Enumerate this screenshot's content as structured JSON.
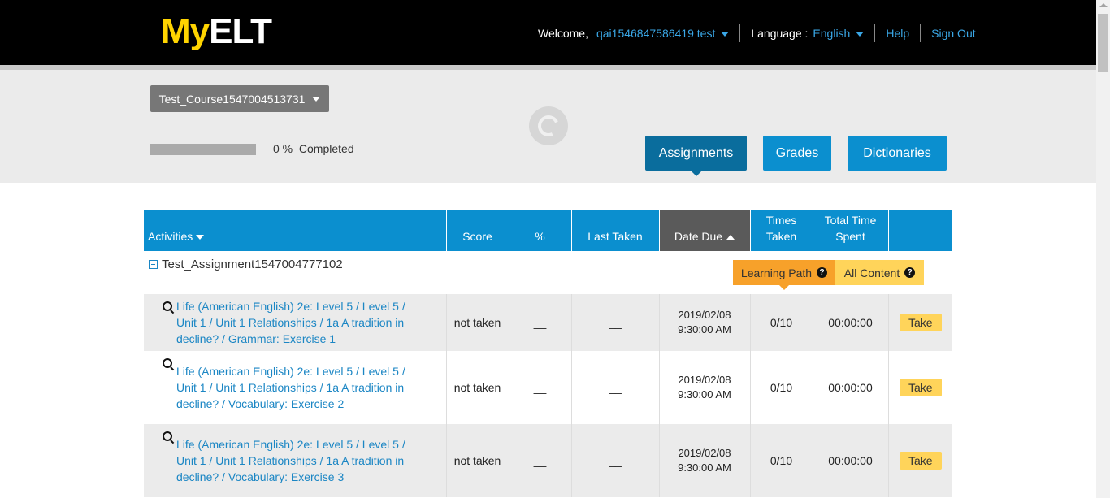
{
  "header": {
    "logo_my": "My",
    "logo_elt": "ELT",
    "welcome_label": "Welcome,",
    "username": "qai1546847586419 test",
    "language_label": "Language :",
    "language_value": "English",
    "help": "Help",
    "sign_out": "Sign Out"
  },
  "course": {
    "selector_label": "Test_Course1547004513731",
    "progress_percent": 0,
    "progress_text": "0 %  Completed"
  },
  "tabs": [
    {
      "label": "Assignments",
      "active": true
    },
    {
      "label": "Grades",
      "active": false
    },
    {
      "label": "Dictionaries",
      "active": false
    }
  ],
  "table": {
    "headers": {
      "activities": "Activities",
      "score": "Score",
      "percent": "%",
      "last_taken": "Last Taken",
      "date_due": "Date Due",
      "times_taken_1": "Times",
      "times_taken_2": "Taken",
      "total_time_1": "Total Time",
      "total_time_2": "Spent"
    },
    "group_title": "Test_Assignment1547004777102",
    "filters": {
      "learning_path": "Learning Path",
      "all_content": "All Content"
    },
    "rows": [
      {
        "activity": "Life (American English) 2e: Level 5 / Level 5 / Unit 1 / Unit 1 Relationships / 1a A tradition in decline? / Grammar: Exercise 1",
        "score": "not taken",
        "percent": "__",
        "last_taken": "__",
        "due_date": "2019/02/08",
        "due_time": "9:30:00 AM",
        "times_taken": "0/10",
        "time_spent": "00:00:00",
        "action": "Take"
      },
      {
        "activity": "Life (American English) 2e: Level 5 / Level 5 / Unit 1 / Unit 1 Relationships / 1a A tradition in decline? / Vocabulary: Exercise 2",
        "score": "not taken",
        "percent": "__",
        "last_taken": "__",
        "due_date": "2019/02/08",
        "due_time": "9:30:00 AM",
        "times_taken": "0/10",
        "time_spent": "00:00:00",
        "action": "Take"
      },
      {
        "activity": "Life (American English) 2e: Level 5 / Level 5 / Unit 1 / Unit 1 Relationships / 1a A tradition in decline? / Vocabulary: Exercise 3",
        "score": "not taken",
        "percent": "__",
        "last_taken": "__",
        "due_date": "2019/02/08",
        "due_time": "9:30:00 AM",
        "times_taken": "0/10",
        "time_spent": "00:00:00",
        "action": "Take"
      }
    ]
  }
}
